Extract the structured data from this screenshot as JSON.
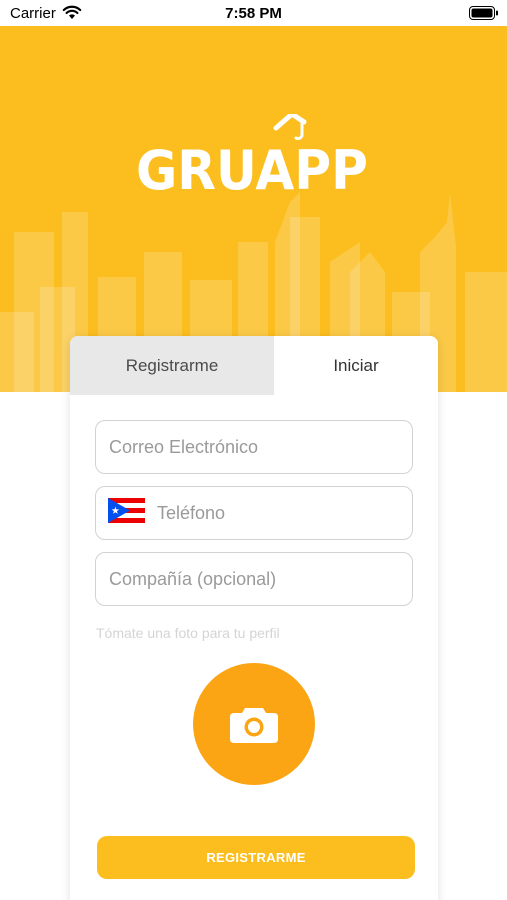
{
  "status_bar": {
    "carrier": "Carrier",
    "time": "7:58 PM"
  },
  "header": {
    "logo_text": "GRUAPP",
    "background_color": "#FBBE1E"
  },
  "tabs": [
    {
      "label": "Registrarme",
      "selected": true
    },
    {
      "label": "Iniciar",
      "selected": false
    }
  ],
  "form": {
    "email": {
      "placeholder": "Correo Electrónico",
      "value": ""
    },
    "phone": {
      "placeholder": "Teléfono",
      "value": "",
      "flag": "puerto-rico-flag-icon"
    },
    "company": {
      "placeholder": "Compañía (opcional)",
      "value": ""
    },
    "photo_hint": "Tómate una foto para tu perfil",
    "camera_icon": "camera-icon",
    "submit_label": "REGISTRARME"
  },
  "colors": {
    "brand_yellow": "#FBBE1E",
    "camera_orange": "#FBA414"
  }
}
